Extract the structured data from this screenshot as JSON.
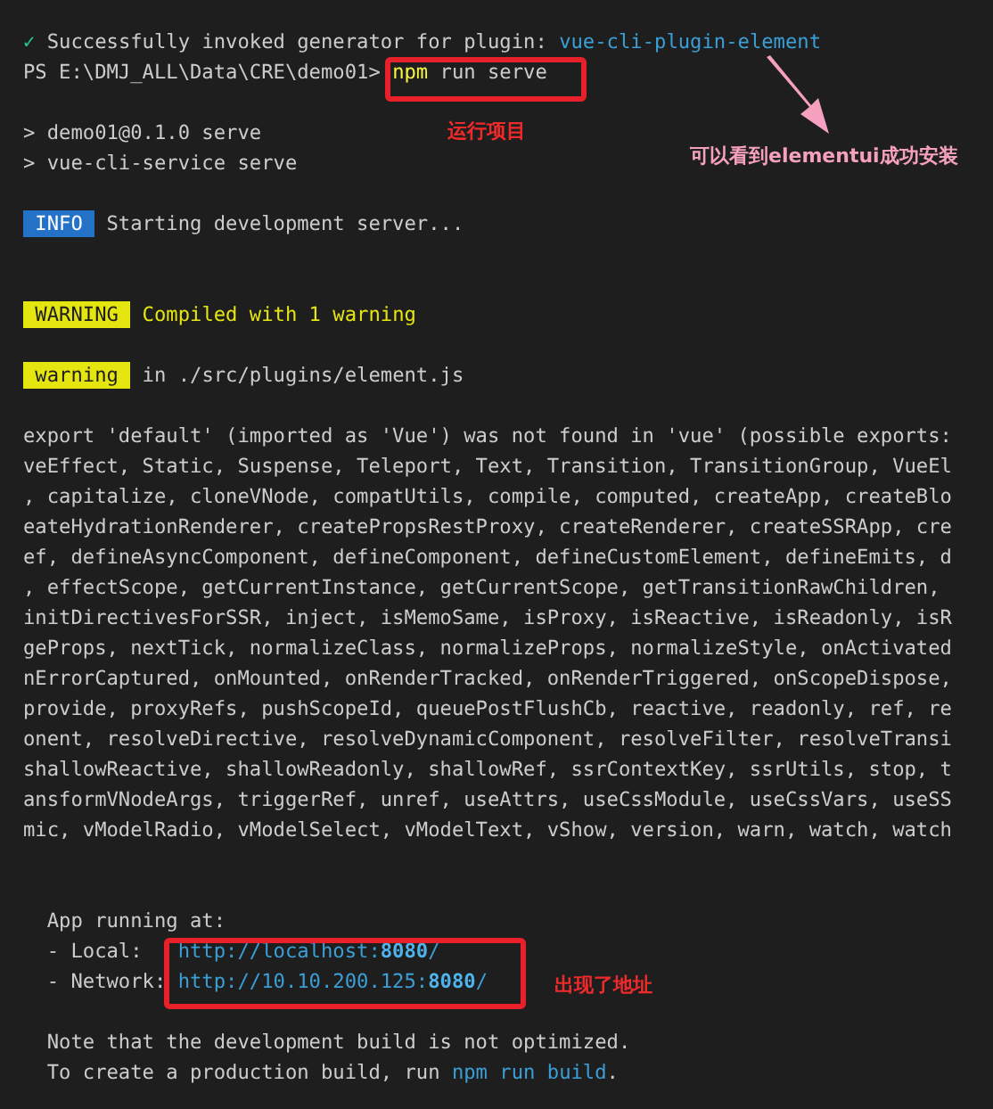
{
  "terminal": {
    "lines": [
      {
        "kind": "text",
        "segments": [
          {
            "kind": "check",
            "text": "✓"
          },
          {
            "kind": "plain",
            "text": " Successfully invoked generator for plugin: "
          },
          {
            "kind": "link",
            "text": "vue-cli-plugin-element"
          }
        ]
      },
      {
        "kind": "text",
        "segments": [
          {
            "kind": "plain",
            "text": "PS E:\\DMJ_ALL\\Data\\CRE\\demo01> "
          },
          {
            "kind": "command",
            "text": "npm"
          },
          {
            "kind": "plain",
            "text": " run serve"
          }
        ]
      },
      {
        "kind": "blank"
      },
      {
        "kind": "text",
        "segments": [
          {
            "kind": "plain",
            "text": "> demo01@0.1.0 serve"
          }
        ]
      },
      {
        "kind": "text",
        "segments": [
          {
            "kind": "plain",
            "text": "> vue-cli-service serve"
          }
        ]
      },
      {
        "kind": "blank"
      },
      {
        "kind": "text",
        "segments": [
          {
            "kind": "info-badge",
            "text": " INFO "
          },
          {
            "kind": "plain",
            "text": " Starting development server..."
          }
        ]
      },
      {
        "kind": "blank"
      },
      {
        "kind": "blank"
      },
      {
        "kind": "text",
        "segments": [
          {
            "kind": "warn-badge",
            "text": " WARNING "
          },
          {
            "kind": "warn",
            "text": " Compiled with 1 warning"
          }
        ]
      },
      {
        "kind": "blank"
      },
      {
        "kind": "text",
        "segments": [
          {
            "kind": "warn-badge",
            "text": " warning "
          },
          {
            "kind": "plain",
            "text": " in ./src/plugins/element.js"
          }
        ]
      },
      {
        "kind": "blank"
      },
      {
        "kind": "text",
        "segments": [
          {
            "kind": "plain",
            "text": "export 'default' (imported as 'Vue') was not found in 'vue' (possible exports:"
          }
        ]
      },
      {
        "kind": "text",
        "segments": [
          {
            "kind": "plain",
            "text": "veEffect, Static, Suspense, Teleport, Text, Transition, TransitionGroup, VueEl"
          }
        ]
      },
      {
        "kind": "text",
        "segments": [
          {
            "kind": "plain",
            "text": ", capitalize, cloneVNode, compatUtils, compile, computed, createApp, createBlo"
          }
        ]
      },
      {
        "kind": "text",
        "segments": [
          {
            "kind": "plain",
            "text": "eateHydrationRenderer, createPropsRestProxy, createRenderer, createSSRApp, cre"
          }
        ]
      },
      {
        "kind": "text",
        "segments": [
          {
            "kind": "plain",
            "text": "ef, defineAsyncComponent, defineComponent, defineCustomElement, defineEmits, d"
          }
        ]
      },
      {
        "kind": "text",
        "segments": [
          {
            "kind": "plain",
            "text": ", effectScope, getCurrentInstance, getCurrentScope, getTransitionRawChildren,"
          }
        ]
      },
      {
        "kind": "text",
        "segments": [
          {
            "kind": "plain",
            "text": "initDirectivesForSSR, inject, isMemoSame, isProxy, isReactive, isReadonly, isR"
          }
        ]
      },
      {
        "kind": "text",
        "segments": [
          {
            "kind": "plain",
            "text": "geProps, nextTick, normalizeClass, normalizeProps, normalizeStyle, onActivated"
          }
        ]
      },
      {
        "kind": "text",
        "segments": [
          {
            "kind": "plain",
            "text": "nErrorCaptured, onMounted, onRenderTracked, onRenderTriggered, onScopeDispose,"
          }
        ]
      },
      {
        "kind": "text",
        "segments": [
          {
            "kind": "plain",
            "text": "provide, proxyRefs, pushScopeId, queuePostFlushCb, reactive, readonly, ref, re"
          }
        ]
      },
      {
        "kind": "text",
        "segments": [
          {
            "kind": "plain",
            "text": "onent, resolveDirective, resolveDynamicComponent, resolveFilter, resolveTransi"
          }
        ]
      },
      {
        "kind": "text",
        "segments": [
          {
            "kind": "plain",
            "text": "shallowReactive, shallowReadonly, shallowRef, ssrContextKey, ssrUtils, stop, t"
          }
        ]
      },
      {
        "kind": "text",
        "segments": [
          {
            "kind": "plain",
            "text": "ansformVNodeArgs, triggerRef, unref, useAttrs, useCssModule, useCssVars, useSS"
          }
        ]
      },
      {
        "kind": "text",
        "segments": [
          {
            "kind": "plain",
            "text": "mic, vModelRadio, vModelSelect, vModelText, vShow, version, warn, watch, watch"
          }
        ]
      },
      {
        "kind": "blank"
      },
      {
        "kind": "blank"
      },
      {
        "kind": "text",
        "segments": [
          {
            "kind": "plain",
            "text": "  App running at:"
          }
        ]
      },
      {
        "kind": "text",
        "segments": [
          {
            "kind": "plain",
            "text": "  - Local:   "
          },
          {
            "kind": "link",
            "text": "http://localhost:"
          },
          {
            "kind": "link-bold",
            "text": "8080"
          },
          {
            "kind": "link",
            "text": "/"
          }
        ]
      },
      {
        "kind": "text",
        "segments": [
          {
            "kind": "plain",
            "text": "  - Network: "
          },
          {
            "kind": "link",
            "text": "http://10.10.200.125:"
          },
          {
            "kind": "link-bold",
            "text": "8080"
          },
          {
            "kind": "link",
            "text": "/"
          }
        ]
      },
      {
        "kind": "blank"
      },
      {
        "kind": "text",
        "segments": [
          {
            "kind": "plain",
            "text": "  Note that the development build is not optimized."
          }
        ]
      },
      {
        "kind": "text",
        "segments": [
          {
            "kind": "plain",
            "text": "  To create a production build, run "
          },
          {
            "kind": "link",
            "text": "npm run build"
          },
          {
            "kind": "plain",
            "text": "."
          }
        ]
      }
    ]
  },
  "annotations": [
    {
      "kind": "box"
    },
    {
      "kind": "label",
      "text": "运行项目"
    },
    {
      "kind": "arrow"
    },
    {
      "kind": "pink-label",
      "text": "可以看到elementui成功安装"
    },
    {
      "kind": "box"
    },
    {
      "kind": "label",
      "text": "出现了地址"
    }
  ]
}
